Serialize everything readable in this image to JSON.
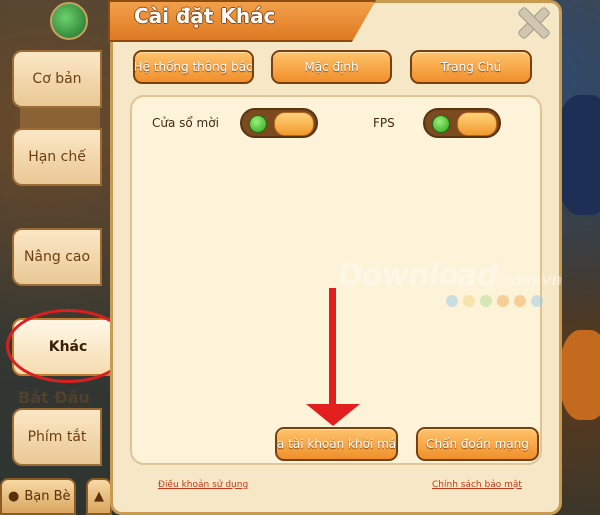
{
  "dialog": {
    "title": "Cài đặt Khác"
  },
  "tabs": [
    {
      "label": "Cơ bản"
    },
    {
      "label": "Hạn chế"
    },
    {
      "label": "Nâng cao"
    },
    {
      "label": "Khác"
    },
    {
      "label": "Phím tắt"
    }
  ],
  "background": {
    "partial_text": "Bắt Đầu",
    "friends_label": "Bạn Bè"
  },
  "top_buttons": {
    "notifications": "Hệ thống thông báo",
    "default": "Mặc định",
    "home": "Trang Chủ"
  },
  "settings": {
    "popup_window": {
      "label": "Cửa sổ mời",
      "enabled": true
    },
    "fps": {
      "label": "FPS",
      "enabled": true
    }
  },
  "bottom_buttons": {
    "remove_account": "a tài khoản khỏi máy c",
    "network_diagnosis": "Chẩn đoán mạng"
  },
  "links": {
    "terms": "Điều khoản sử dụng",
    "privacy": "Chính sách bảo mật"
  },
  "watermark": {
    "brand": "Download",
    "suffix": ".com.vn"
  },
  "colors": {
    "accent": "#f08f2a",
    "highlight": "#d91f1f",
    "panel": "#f6e8c6"
  }
}
